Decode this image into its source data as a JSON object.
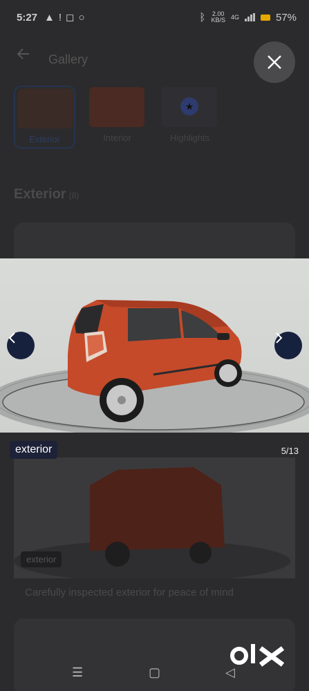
{
  "status": {
    "time": "5:27",
    "speed_value": "2.00",
    "speed_unit": "KB/S",
    "network": "4G",
    "battery": "57%"
  },
  "gallery": {
    "title": "Gallery",
    "tabs": [
      {
        "label": "Exterior",
        "active": true
      },
      {
        "label": "Interior",
        "active": false
      },
      {
        "label": "Highlights",
        "active": false
      }
    ],
    "section_title": "Exterior",
    "section_count": "(8)",
    "ghost_tag": "exterior",
    "ghost_caption": "Carefully inspected exterior for peace of mind"
  },
  "viewer": {
    "tag": "exterior",
    "counter": "5/13"
  },
  "watermark": "olx",
  "colors": {
    "car_body": "#c44a2a",
    "nav_button": "#16213e",
    "tag_bg": "#1d2238",
    "overlay": "#2b2b2d"
  }
}
